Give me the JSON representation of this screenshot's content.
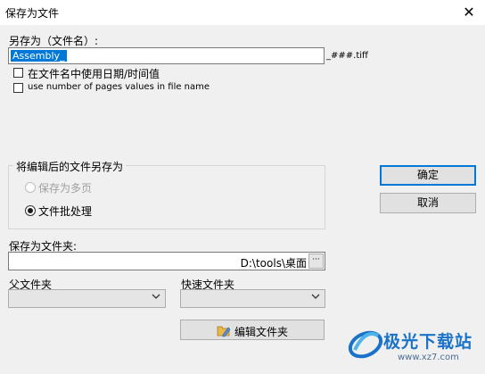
{
  "window": {
    "title": "保存为文件",
    "close_glyph": "✕"
  },
  "save_as": {
    "label": "另存为（文件名）:",
    "value": "Assembly_",
    "suffix": "_###.tiff",
    "opt_datetime": "在文件名中使用日期/时间值",
    "opt_pages": "use number of pages values in  file name"
  },
  "edited_group": {
    "legend": "将编辑后的文件另存为",
    "radio_multipage": "保存为多页",
    "radio_batch": "文件批处理",
    "selected": "文件批处理"
  },
  "buttons": {
    "ok": "确定",
    "cancel": "取消",
    "edit_folder": "编辑文件夹",
    "browse": "···"
  },
  "folder": {
    "label": "保存为文件夹:",
    "value": "D:\\tools\\桌面",
    "parent_label": "父文件夹",
    "quick_label": "快速文件夹"
  },
  "watermark": {
    "brand": "极光下载站",
    "url": "www.xz7.com"
  },
  "colors": {
    "selection": "#0078d7",
    "default_button_border": "#0078d7",
    "watermark_blue": "#1a73c9"
  }
}
